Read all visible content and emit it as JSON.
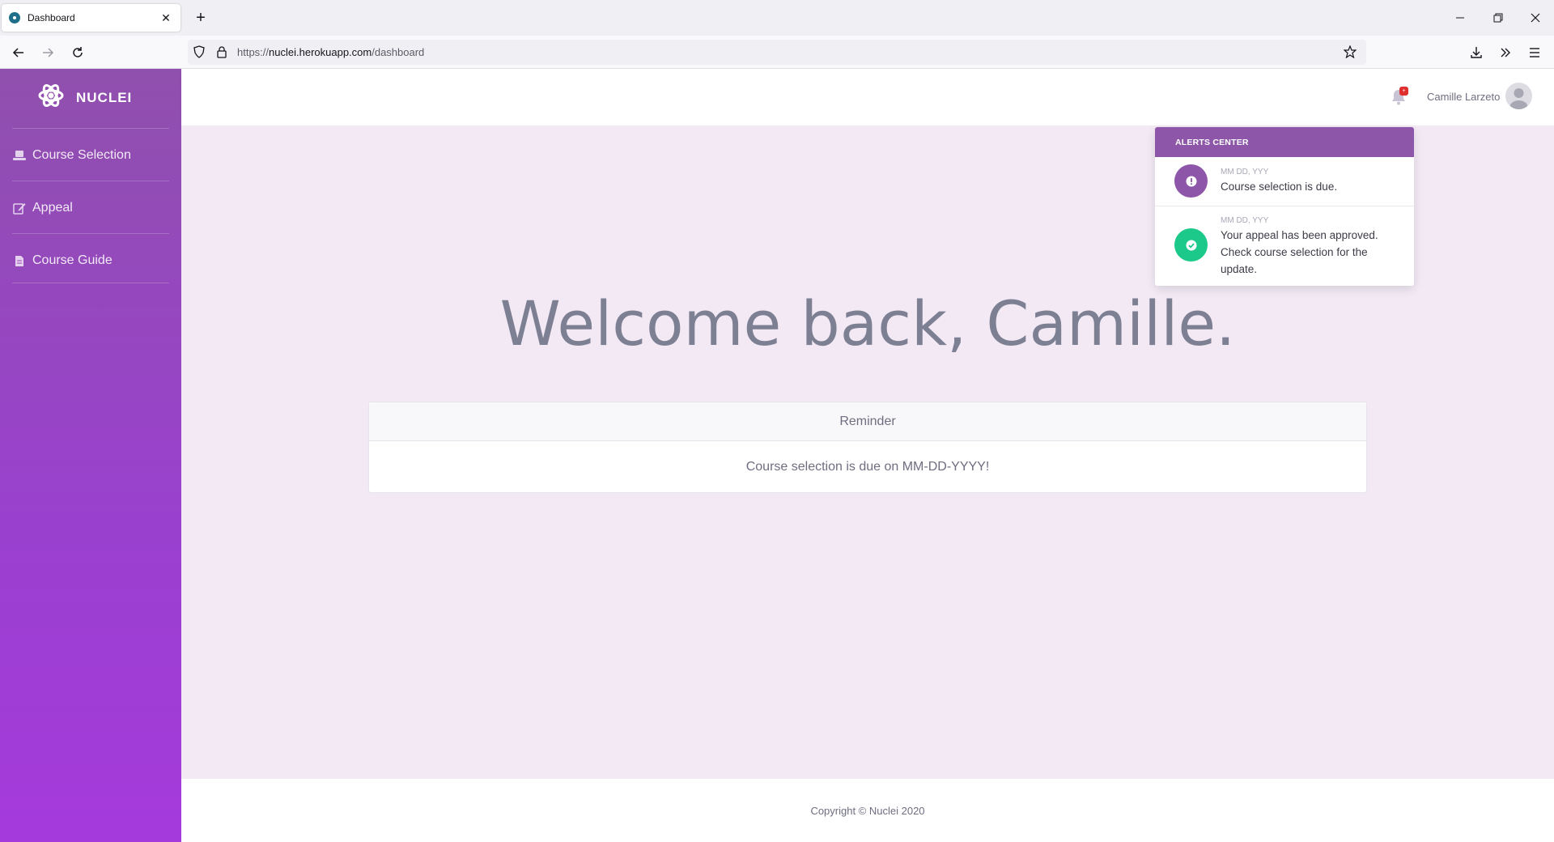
{
  "browser": {
    "tab_title": "Dashboard",
    "url_prefix": "https://",
    "url_host": "nuclei.herokuapp.com",
    "url_path": "/dashboard"
  },
  "sidebar": {
    "brand": "NUCLEI",
    "items": [
      {
        "label": "Course Selection",
        "icon": "laptop-icon"
      },
      {
        "label": "Appeal",
        "icon": "edit-icon"
      },
      {
        "label": "Course Guide",
        "icon": "file-icon"
      }
    ]
  },
  "topbar": {
    "user_name": "Camille Larzeto",
    "notification_badge": "+"
  },
  "alerts": {
    "title": "ALERTS CENTER",
    "items": [
      {
        "date": "MM DD, YYY",
        "text": "Course selection is due.",
        "icon": "exclamation-icon",
        "color": "#8d56a8"
      },
      {
        "date": "MM DD, YYY",
        "text": "Your appeal has been approved. Check course selection for the update.",
        "icon": "check-icon",
        "color": "#1cc88a"
      }
    ]
  },
  "main": {
    "welcome": "Welcome back, Camille.",
    "card_header": "Reminder",
    "card_body": "Course selection is due on MM-DD-YYYY!"
  },
  "footer": {
    "copyright": "Copyright © Nuclei 2020"
  },
  "colors": {
    "sidebar_top": "#9050ad",
    "sidebar_bottom": "#a53adc",
    "alerts_header": "#8d56a8",
    "success": "#1cc88a",
    "content_bg": "#f2e9f5"
  }
}
